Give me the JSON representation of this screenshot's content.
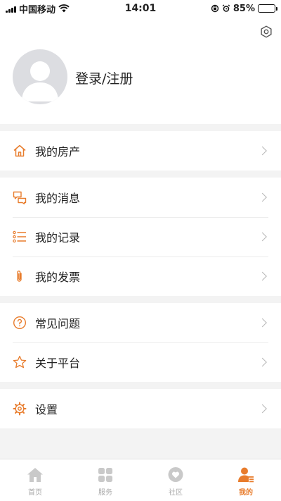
{
  "status_bar": {
    "carrier": "中国移动",
    "time": "14:01",
    "battery": "85%",
    "battery_level": 0.85
  },
  "profile": {
    "login_text": "登录/注册"
  },
  "menu": {
    "property": "我的房产",
    "messages": "我的消息",
    "records": "我的记录",
    "invoices": "我的发票",
    "faq": "常见问题",
    "about": "关于平台",
    "settings": "设置"
  },
  "tabs": [
    {
      "label": "首页",
      "icon": "home-icon",
      "active": false
    },
    {
      "label": "服务",
      "icon": "grid-icon",
      "active": false
    },
    {
      "label": "社区",
      "icon": "community-icon",
      "active": false
    },
    {
      "label": "我的",
      "icon": "profile-icon",
      "active": true
    }
  ],
  "colors": {
    "accent": "#E87C2C",
    "inactive": "#AAAAAA",
    "background": "#F3F3F3"
  }
}
